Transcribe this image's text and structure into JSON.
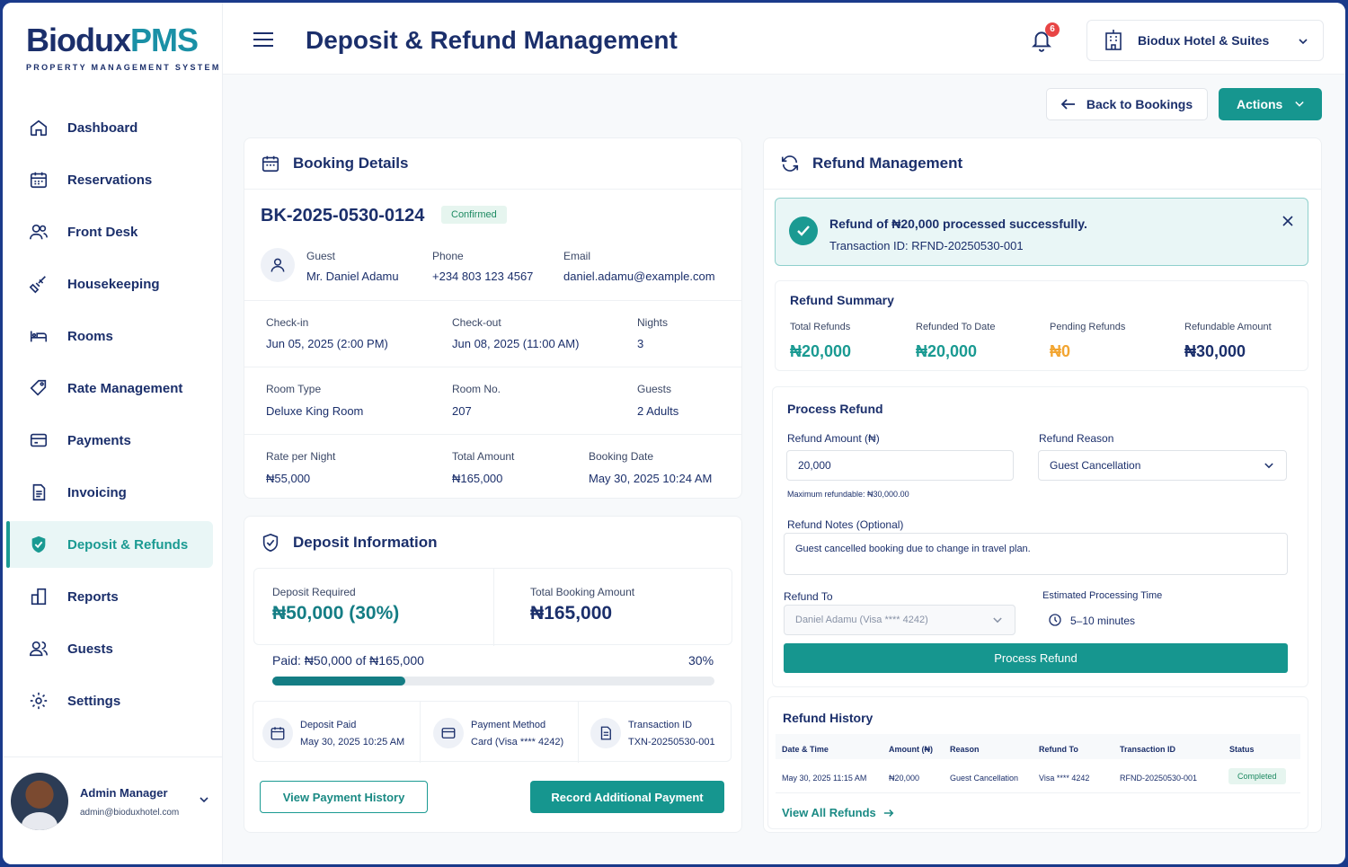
{
  "brand": {
    "name_part1": "Biodux",
    "name_part2": "PMS",
    "tagline": "PROPERTY MANAGEMENT SYSTEM"
  },
  "sidebar": {
    "items": [
      {
        "label": "Dashboard",
        "icon": "home-icon"
      },
      {
        "label": "Reservations",
        "icon": "calendar-icon"
      },
      {
        "label": "Front Desk",
        "icon": "users-icon"
      },
      {
        "label": "Housekeeping",
        "icon": "broom-icon"
      },
      {
        "label": "Rooms",
        "icon": "bed-icon"
      },
      {
        "label": "Rate Management",
        "icon": "tag-icon"
      },
      {
        "label": "Payments",
        "icon": "card-icon"
      },
      {
        "label": "Invoicing",
        "icon": "document-icon"
      },
      {
        "label": "Deposit & Refunds",
        "icon": "shield-check-icon",
        "active": true
      },
      {
        "label": "Reports",
        "icon": "reports-icon"
      },
      {
        "label": "Guests",
        "icon": "guests-icon"
      },
      {
        "label": "Settings",
        "icon": "gear-icon"
      }
    ]
  },
  "user": {
    "name": "Admin Manager",
    "email": "admin@bioduxhotel.com"
  },
  "header": {
    "title": "Deposit & Refund Management",
    "notifications": "6",
    "hotel": "Biodux Hotel & Suites"
  },
  "toolbar": {
    "back_label": "Back to Bookings",
    "actions_label": "Actions"
  },
  "booking": {
    "title": "Booking Details",
    "id": "BK-2025-0530-0124",
    "status": "Confirmed",
    "guest_label": "Guest",
    "guest": "Mr. Daniel Adamu",
    "phone_label": "Phone",
    "phone": "+234 803 123 4567",
    "email_label": "Email",
    "email": "daniel.adamu@example.com",
    "checkin_label": "Check-in",
    "checkin": "Jun 05, 2025 (2:00 PM)",
    "checkout_label": "Check-out",
    "checkout": "Jun 08, 2025 (11:00 AM)",
    "nights_label": "Nights",
    "nights": "3",
    "roomtype_label": "Room Type",
    "roomtype": "Deluxe King Room",
    "roomno_label": "Room No.",
    "roomno": "207",
    "guests_label": "Guests",
    "guests": "2 Adults",
    "rate_label": "Rate per Night",
    "rate": "₦55,000",
    "total_label": "Total Amount",
    "total": "₦165,000",
    "bookdate_label": "Booking Date",
    "bookdate": "May 30, 2025 10:24 AM"
  },
  "deposit": {
    "title": "Deposit Information",
    "required_label": "Deposit Required",
    "required": "₦50,000 (30%)",
    "total_label": "Total Booking Amount",
    "total": "₦165,000",
    "paid_text": "Paid: ₦50,000 of ₦165,000",
    "percent_text": "30%",
    "progress": 0.3,
    "paid_label": "Deposit Paid",
    "paid_date": "May 30, 2025 10:25 AM",
    "method_label": "Payment Method",
    "method": "Card (Visa **** 4242)",
    "txn_label": "Transaction ID",
    "txn": "TXN-20250530-001",
    "history_btn": "View Payment History",
    "record_btn": "Record Additional Payment"
  },
  "refund": {
    "title": "Refund Management",
    "alert_title": "Refund of ₦20,000 processed successfully.",
    "alert_txn": "Transaction ID: RFND-20250530-001",
    "summary_title": "Refund Summary",
    "total_label": "Total Refunds",
    "total": "₦20,000",
    "refunded_label": "Refunded To Date",
    "refunded": "₦20,000",
    "pending_label": "Pending Refunds",
    "pending": "₦0",
    "refundable_label": "Refundable Amount",
    "refundable": "₦30,000",
    "process_title": "Process Refund",
    "amount_label": "Refund Amount (₦)",
    "amount": "20,000",
    "max_note": "Maximum refundable: ₦30,000.00",
    "reason_label": "Refund Reason",
    "reason": "Guest Cancellation",
    "notes_label": "Refund Notes (Optional)",
    "notes": "Guest cancelled booking due to change in travel plan.",
    "to_label": "Refund To",
    "to": "Daniel Adamu (Visa **** 4242)",
    "time_label": "Estimated Processing Time",
    "time": "5–10 minutes",
    "process_btn": "Process Refund",
    "history_title": "Refund History",
    "columns": [
      "Date & Time",
      "Amount (₦)",
      "Reason",
      "Refund To",
      "Transaction ID",
      "Status"
    ],
    "rows": [
      [
        "May 30, 2025 11:15 AM",
        "₦20,000",
        "Guest Cancellation",
        "Visa **** 4242",
        "RFND-20250530-001",
        "Completed"
      ]
    ],
    "view_all": "View All Refunds"
  },
  "colors": {
    "accent": "#16968f",
    "navy": "#1b2f6b",
    "brand_pms": "#1a90a6",
    "pending": "#f2a531",
    "success_bg": "#e9f6f6"
  }
}
